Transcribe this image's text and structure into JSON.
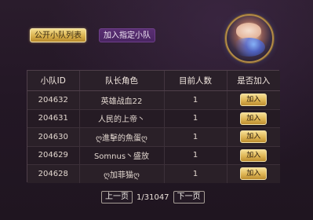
{
  "tabs": {
    "public_list": "公开小队列表",
    "join_specified": "加入指定小队"
  },
  "table": {
    "headers": [
      "小队ID",
      "队长角色",
      "目前人数",
      "是否加入"
    ],
    "rows": [
      {
        "id": "204632",
        "leader": "英雄战血22",
        "count": "1",
        "action": "加入"
      },
      {
        "id": "204631",
        "leader": "人民的上帝丶",
        "count": "1",
        "action": "加入"
      },
      {
        "id": "204630",
        "leader": "ღ進擊的魚蛋ღ",
        "count": "1",
        "action": "加入"
      },
      {
        "id": "204629",
        "leader": "Somnus丶盛放",
        "count": "1",
        "action": "加入"
      },
      {
        "id": "204628",
        "leader": "ღ加菲猫ღ",
        "count": "1",
        "action": "加入"
      }
    ]
  },
  "pagination": {
    "prev": "上一页",
    "page_info": "1/31047",
    "next": "下一页"
  }
}
